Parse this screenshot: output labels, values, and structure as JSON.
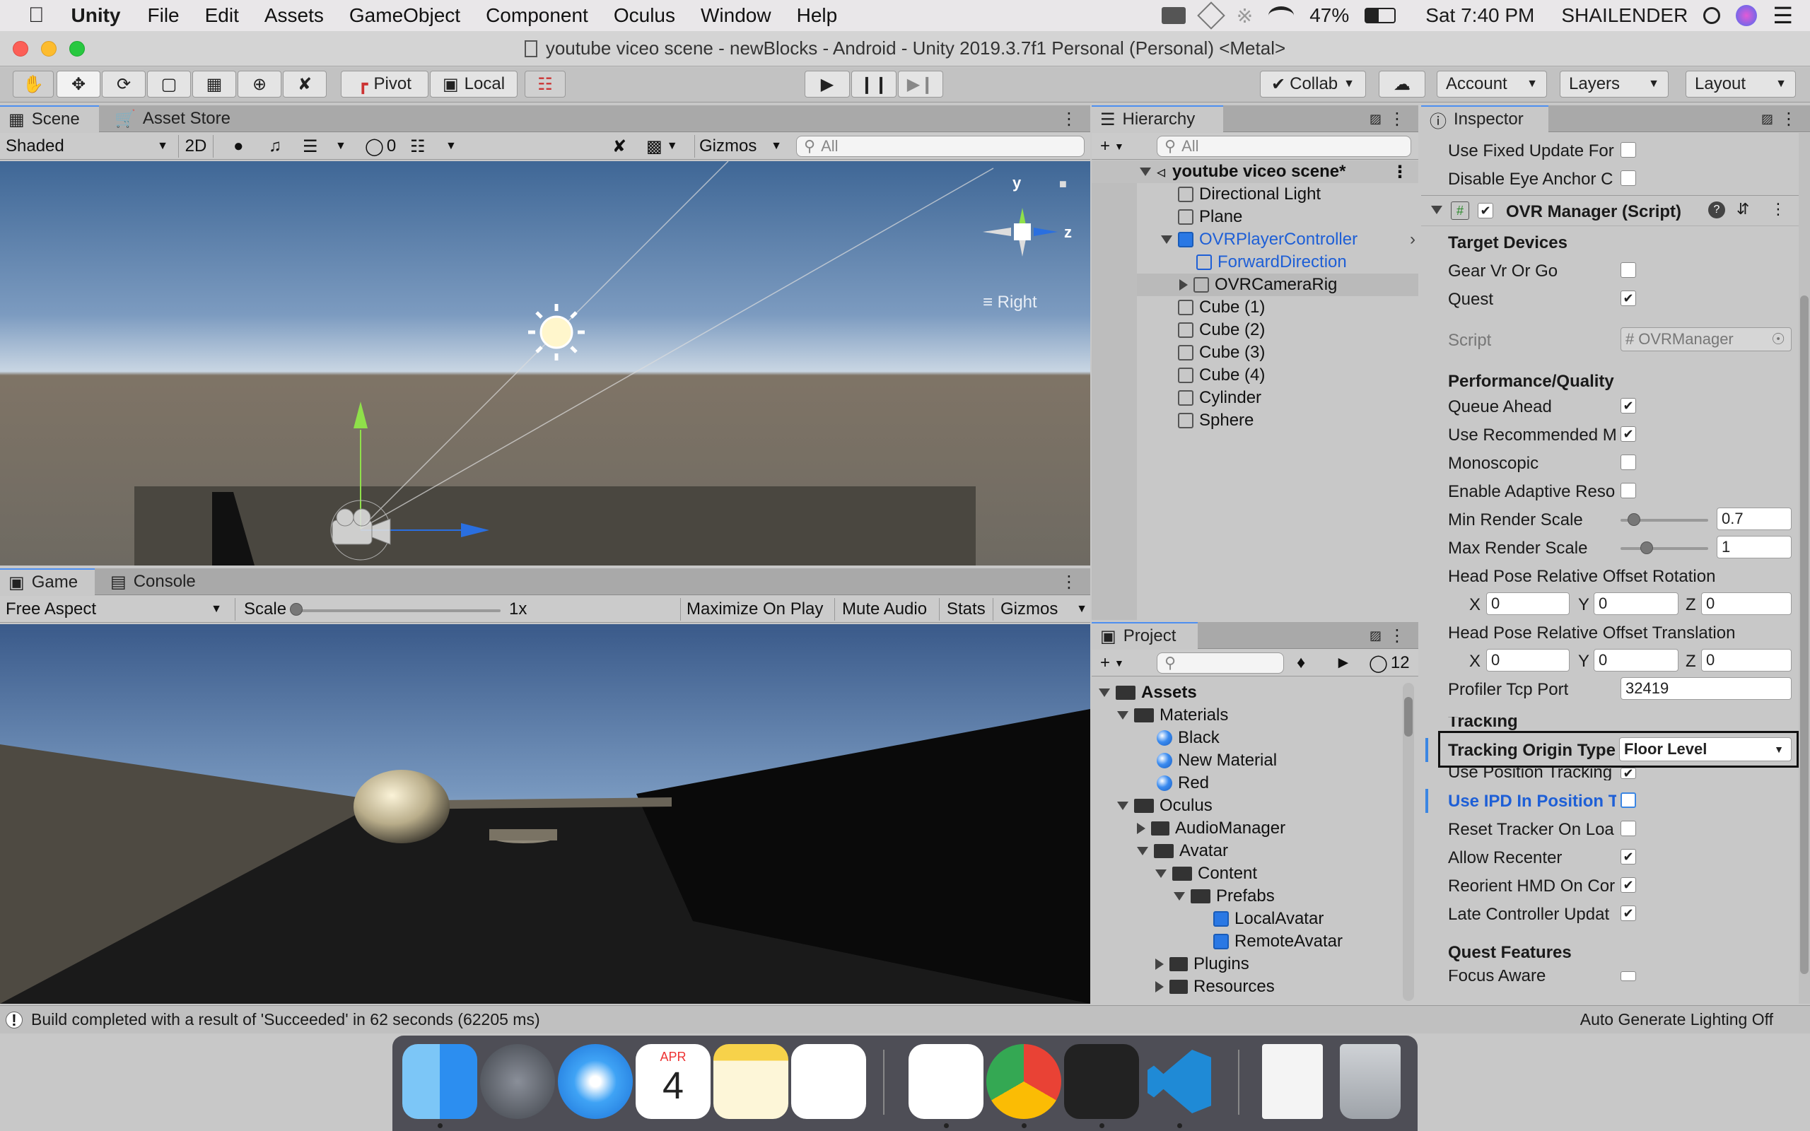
{
  "menubar": {
    "app": "Unity",
    "items": [
      "File",
      "Edit",
      "Assets",
      "GameObject",
      "Component",
      "Oculus",
      "Window",
      "Help"
    ],
    "battery": "47%",
    "clock": "Sat 7:40 PM",
    "user": "SHAILENDER"
  },
  "window": {
    "title": "youtube viceo scene - newBlocks - Android - Unity 2019.3.7f1 Personal (Personal) <Metal>"
  },
  "toolbar": {
    "pivot": "Pivot",
    "local": "Local",
    "collab": "Collab",
    "account": "Account",
    "layers": "Layers",
    "layout": "Layout"
  },
  "scene": {
    "tab": "Scene",
    "tab2": "Asset Store",
    "shading": "Shaded",
    "mode2d": "2D",
    "hidden_count": "0",
    "gizmos": "Gizmos",
    "search_placeholder": "All",
    "axis_y": "y",
    "axis_z": "z",
    "view_label": "Right"
  },
  "game": {
    "tab": "Game",
    "tab2": "Console",
    "aspect": "Free Aspect",
    "scale_label": "Scale",
    "scale_value": "1x",
    "maximize": "Maximize On Play",
    "mute": "Mute Audio",
    "stats": "Stats",
    "gizmos": "Gizmos"
  },
  "hierarchy": {
    "tab": "Hierarchy",
    "search_placeholder": "All",
    "scene_name": "youtube viceo scene*",
    "items": [
      "Directional Light",
      "Plane",
      "OVRPlayerController",
      "ForwardDirection",
      "OVRCameraRig",
      "Cube (1)",
      "Cube (2)",
      "Cube (3)",
      "Cube (4)",
      "Cylinder",
      "Sphere"
    ]
  },
  "project": {
    "tab": "Project",
    "hidden_count": "12",
    "items": [
      "Assets",
      "Materials",
      "Black",
      "New Material",
      "Red",
      "Oculus",
      "AudioManager",
      "Avatar",
      "Content",
      "Prefabs",
      "LocalAvatar",
      "RemoteAvatar",
      "Plugins",
      "Resources"
    ]
  },
  "inspector": {
    "tab": "Inspector",
    "use_fixed_update": "Use Fixed Update For",
    "disable_eye_anchor": "Disable Eye Anchor C",
    "component": "OVR Manager (Script)",
    "target_devices": "Target Devices",
    "gear_vr": "Gear Vr Or Go",
    "quest": "Quest",
    "script_label": "Script",
    "script_value": "OVRManager",
    "perf_header": "Performance/Quality",
    "queue_ahead": "Queue Ahead",
    "use_recommended": "Use Recommended M",
    "monoscopic": "Monoscopic",
    "adaptive_res": "Enable Adaptive Reso",
    "min_render": "Min Render Scale",
    "min_render_value": "0.7",
    "min_render_level": 0.15,
    "max_render": "Max Render Scale",
    "max_render_value": "1",
    "max_render_level": 0.3,
    "offset_rotation": "Head Pose Relative Offset Rotation",
    "offset_translation": "Head Pose Relative Offset Translation",
    "x": "X",
    "y": "Y",
    "z": "Z",
    "zero": "0",
    "profiler_port": "Profiler Tcp Port",
    "profiler_port_value": "32419",
    "tracking_header": "Tracking",
    "tracking_origin": "Tracking Origin Type",
    "tracking_origin_value": "Floor Level",
    "use_position_tracking": "Use Position Tracking",
    "use_ipd": "Use IPD In Position T",
    "reset_tracker": "Reset Tracker On Loa",
    "allow_recenter": "Allow Recenter",
    "reorient_hmd": "Reorient HMD On Cor",
    "late_controller": "Late Controller Updat",
    "quest_features": "Quest Features",
    "focus_aware": "Focus Aware"
  },
  "statusbar": {
    "message": "Build completed with a result of 'Succeeded' in 62 seconds (62205 ms)",
    "lighting": "Auto Generate Lighting Off"
  },
  "dock": {
    "calendar_month": "APR",
    "calendar_day": "4"
  }
}
